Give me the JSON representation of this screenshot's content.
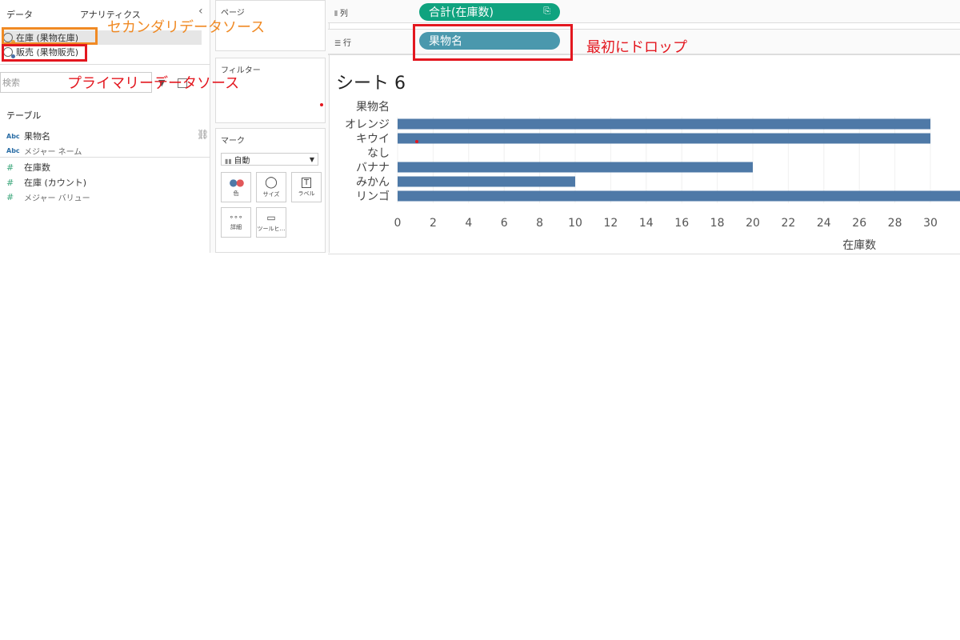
{
  "left_pane": {
    "tabs": [
      "データ",
      "アナリティクス"
    ],
    "collapse_glyph": "‹",
    "datasources": [
      {
        "label": "在庫 (果物在庫)",
        "role": "secondary"
      },
      {
        "label": "販売 (果物販売)",
        "role": "primary"
      }
    ],
    "search_placeholder": "検索",
    "table_header": "テーブル",
    "fields": [
      {
        "type": "Abc",
        "label": "果物名",
        "linked": true
      },
      {
        "type": "Abc",
        "label": "メジャー ネーム",
        "muted": true
      },
      {
        "type": "#",
        "label": "在庫数"
      },
      {
        "type": "#",
        "label": "在庫 (カウント)"
      },
      {
        "type": "#",
        "label": "メジャー バリュー",
        "muted": true
      }
    ]
  },
  "cards": {
    "pages": "ページ",
    "filters": "フィルター",
    "marks": "マーク",
    "mark_type": "自動",
    "mark_buttons": [
      "色",
      "サイズ",
      "ラベル",
      "詳細",
      "ツールヒ…"
    ]
  },
  "shelves": {
    "columns_label": "列",
    "rows_label": "行",
    "columns_pill": "合計(在庫数)",
    "rows_pill": "果物名"
  },
  "sheet": {
    "title": "シート 6"
  },
  "chart_data": {
    "type": "bar",
    "orientation": "horizontal",
    "ylabel": "果物名",
    "xlabel": "在庫数",
    "categories": [
      "オレンジ",
      "キウイ",
      "なし",
      "バナナ",
      "みかん",
      "リンゴ"
    ],
    "values": [
      30,
      30,
      0,
      20,
      10,
      32
    ],
    "xticks": [
      0,
      2,
      4,
      6,
      8,
      10,
      12,
      14,
      16,
      18,
      20,
      22,
      24,
      26,
      28,
      30
    ],
    "xlim": [
      0,
      31.3
    ],
    "bar_color": "#4e79a7"
  },
  "annotations": {
    "secondary": "セカンダリデータソース",
    "primary": "プライマリーデータソース",
    "first_drop": "最初にドロップ"
  },
  "colors": {
    "orange": "#f08a24",
    "red": "#e3171f",
    "green_pill": "#10a37f",
    "blue_pill": "#4a98ad"
  }
}
